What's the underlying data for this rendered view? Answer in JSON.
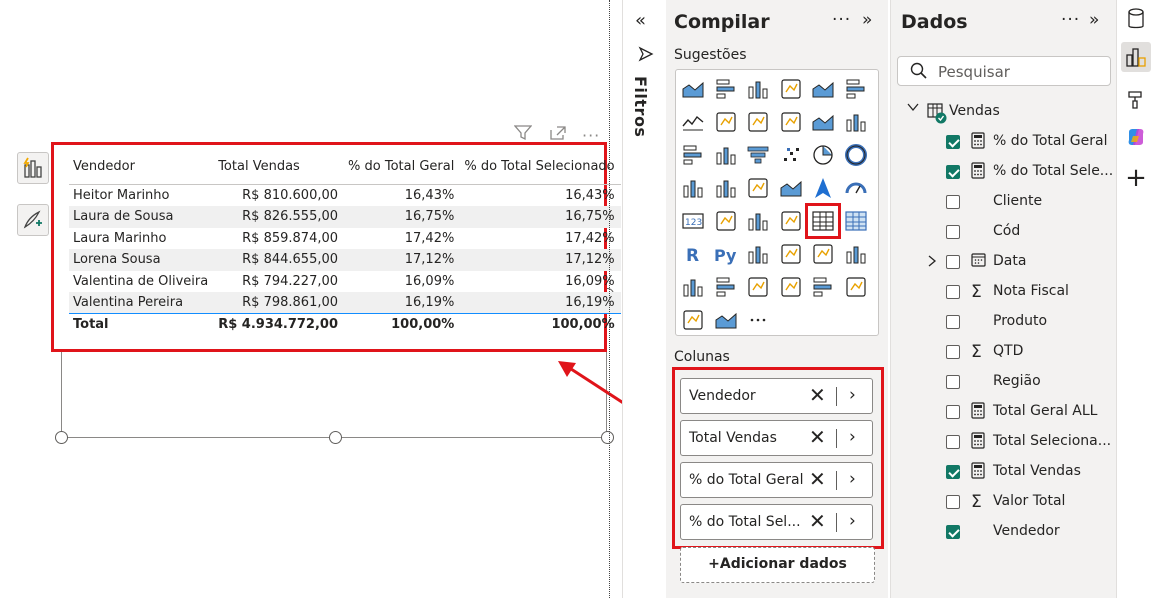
{
  "table": {
    "headers": [
      "Vendedor",
      "Total Vendas",
      "% do Total Geral",
      "% do Total Selecionado"
    ],
    "rows": [
      [
        "Heitor Marinho",
        "R$ 810.600,00",
        "16,43%",
        "16,43%"
      ],
      [
        "Laura de Sousa",
        "R$ 826.555,00",
        "16,75%",
        "16,75%"
      ],
      [
        "Laura Marinho",
        "R$ 859.874,00",
        "17,42%",
        "17,42%"
      ],
      [
        "Lorena Sousa",
        "R$ 844.655,00",
        "17,12%",
        "17,12%"
      ],
      [
        "Valentina de Oliveira",
        "R$ 794.227,00",
        "16,09%",
        "16,09%"
      ],
      [
        "Valentina Pereira",
        "R$ 798.861,00",
        "16,19%",
        "16,19%"
      ]
    ],
    "total": [
      "Total",
      "R$ 4.934.772,00",
      "100,00%",
      "100,00%"
    ]
  },
  "filters": {
    "label": "Filtros"
  },
  "compilar": {
    "title": "Compilar",
    "suggestions_label": "Sugestões",
    "columns_label": "Colunas",
    "wells": [
      "Vendedor",
      "Total Vendas",
      "% do Total Geral",
      "% do Total Sel..."
    ],
    "add_data": "+Adicionar dados",
    "more": "···"
  },
  "dados": {
    "title": "Dados",
    "search_placeholder": "Pesquisar",
    "table_name": "Vendas",
    "fields": [
      {
        "name": "% do Total Geral",
        "icon": "calculator-icon",
        "checked": true
      },
      {
        "name": "% do Total Sele...",
        "icon": "calculator-icon",
        "checked": true
      },
      {
        "name": "Cliente",
        "icon": "",
        "checked": false
      },
      {
        "name": "Cód",
        "icon": "",
        "checked": false
      },
      {
        "name": "Data",
        "icon": "calendar-icon",
        "checked": false,
        "expandable": true
      },
      {
        "name": "Nota Fiscal",
        "icon": "sigma-icon",
        "checked": false
      },
      {
        "name": "Produto",
        "icon": "",
        "checked": false
      },
      {
        "name": "QTD",
        "icon": "sigma-icon",
        "checked": false
      },
      {
        "name": "Região",
        "icon": "",
        "checked": false
      },
      {
        "name": "Total Geral ALL",
        "icon": "calculator-icon",
        "checked": false
      },
      {
        "name": "Total Seleciona...",
        "icon": "calculator-icon",
        "checked": false
      },
      {
        "name": "Total Vendas",
        "icon": "calculator-icon",
        "checked": true
      },
      {
        "name": "Valor Total",
        "icon": "sigma-icon",
        "checked": false
      },
      {
        "name": "Vendedor",
        "icon": "",
        "checked": true
      }
    ]
  },
  "colors": {
    "accent_red": "#e0141a",
    "check_green": "#117865",
    "pane_bg": "#f3f2f1",
    "total_line": "#118dff"
  }
}
